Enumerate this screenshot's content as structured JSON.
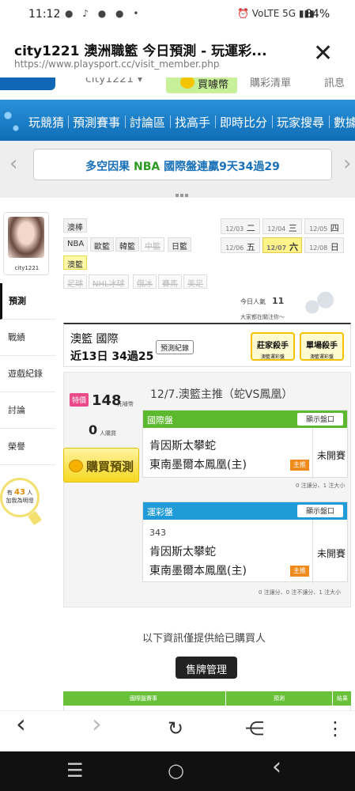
{
  "status_bar": {
    "time": "11:12",
    "left_icons": "● ♪ ● ● •",
    "right_icons": "⏰ VoLTE 5G ▮▮▮",
    "battery": "84%"
  },
  "browser": {
    "title": "city1221 澳洲職籃 今日預測 - 玩運彩...",
    "url": "https://www.playsport.cc/visit_member.php",
    "close_icon": "✕"
  },
  "site_top": {
    "account": "city1221 ▾",
    "buy_label": "買噱幣",
    "cart_label": "購彩清單",
    "msg_label": "訊息"
  },
  "nav": {
    "items": [
      "玩競猜",
      "預測賽事",
      "討論區",
      "找高手",
      "即時比分",
      "玩家搜尋",
      "數據"
    ]
  },
  "banner": {
    "text_blue": "多空因果 ",
    "text_green": "NBA",
    "text_rest": " 國際盤連贏9天34過29",
    "left_arrow": "‹",
    "right_arrow": "›"
  },
  "profile": {
    "name": "city1221"
  },
  "sidebar": {
    "tabs": [
      "預測",
      "戰績",
      "遊戲紀錄",
      "討論",
      "榮譽"
    ],
    "bulb_prefix": "有",
    "bulb_count": "43",
    "bulb_suffix": "人",
    "bulb_text": "加我為明燈"
  },
  "leagues": {
    "row0": [
      "澳棒"
    ],
    "row1": [
      "NBA",
      "歐籃",
      "韓籃",
      "中籃",
      "日籃"
    ],
    "row2": [
      "澳籃"
    ],
    "row3": [
      "足球",
      "NHL冰球",
      "俄冰",
      "賽馬",
      "美足"
    ]
  },
  "dates": [
    {
      "d": "12/03",
      "w": "二"
    },
    {
      "d": "12/04",
      "w": "三"
    },
    {
      "d": "12/05",
      "w": "四"
    },
    {
      "d": "12/06",
      "w": "五"
    },
    {
      "d": "12/07",
      "w": "六"
    },
    {
      "d": "12/08",
      "w": "日"
    }
  ],
  "visitors": {
    "label": "今日人氣",
    "count": "11",
    "note": "大家都在關注你～"
  },
  "record": {
    "line1": "澳籃 國際",
    "line2": "近13日 34過25",
    "history_label": "預測紀錄",
    "badge1": "莊家殺手",
    "badge1_sub": "澳籃運彩盤",
    "badge2": "單場殺手",
    "badge2_sub": "澳籃運彩盤"
  },
  "prediction": {
    "special_tag": "特價",
    "price": "148",
    "price_unit": "元噱幣",
    "buyers": "0",
    "buyers_unit": "人購買",
    "buy_label": "購買預測",
    "title": "12/7.澳籃主推（蛇VS鳳凰）",
    "markets": [
      {
        "name": "國際盤",
        "color": "#5cb82e",
        "show_label": "顯示盤口",
        "number": "",
        "team_away": "肯因斯太攀蛇",
        "team_home": "東南墨爾本鳳凰(主)",
        "host_tag": "主推",
        "state": "未開賽",
        "stats": "0 注讓分、1 注大小"
      },
      {
        "name": "運彩盤",
        "color": "#1f9bd8",
        "show_label": "顯示盤口",
        "number": "343",
        "team_away": "肯因斯太攀蛇",
        "team_home": "東南墨爾本鳳凰(主)",
        "host_tag": "主推",
        "state": "未開賽",
        "stats": "0 注讓分、0 注不讓分、1 注大小"
      }
    ]
  },
  "info_note": "以下資訊僅提供給已購買人",
  "sell_button": "售牌管理",
  "table_header": [
    "國際盤賽事",
    "預測",
    "結果"
  ],
  "bottom_bar": {
    "back": "‹",
    "forward": "›",
    "reload": "↻",
    "share": "⋲",
    "menu": "⋮"
  },
  "sys_nav": {
    "recent": "☰",
    "home": "○",
    "back": "‹"
  }
}
